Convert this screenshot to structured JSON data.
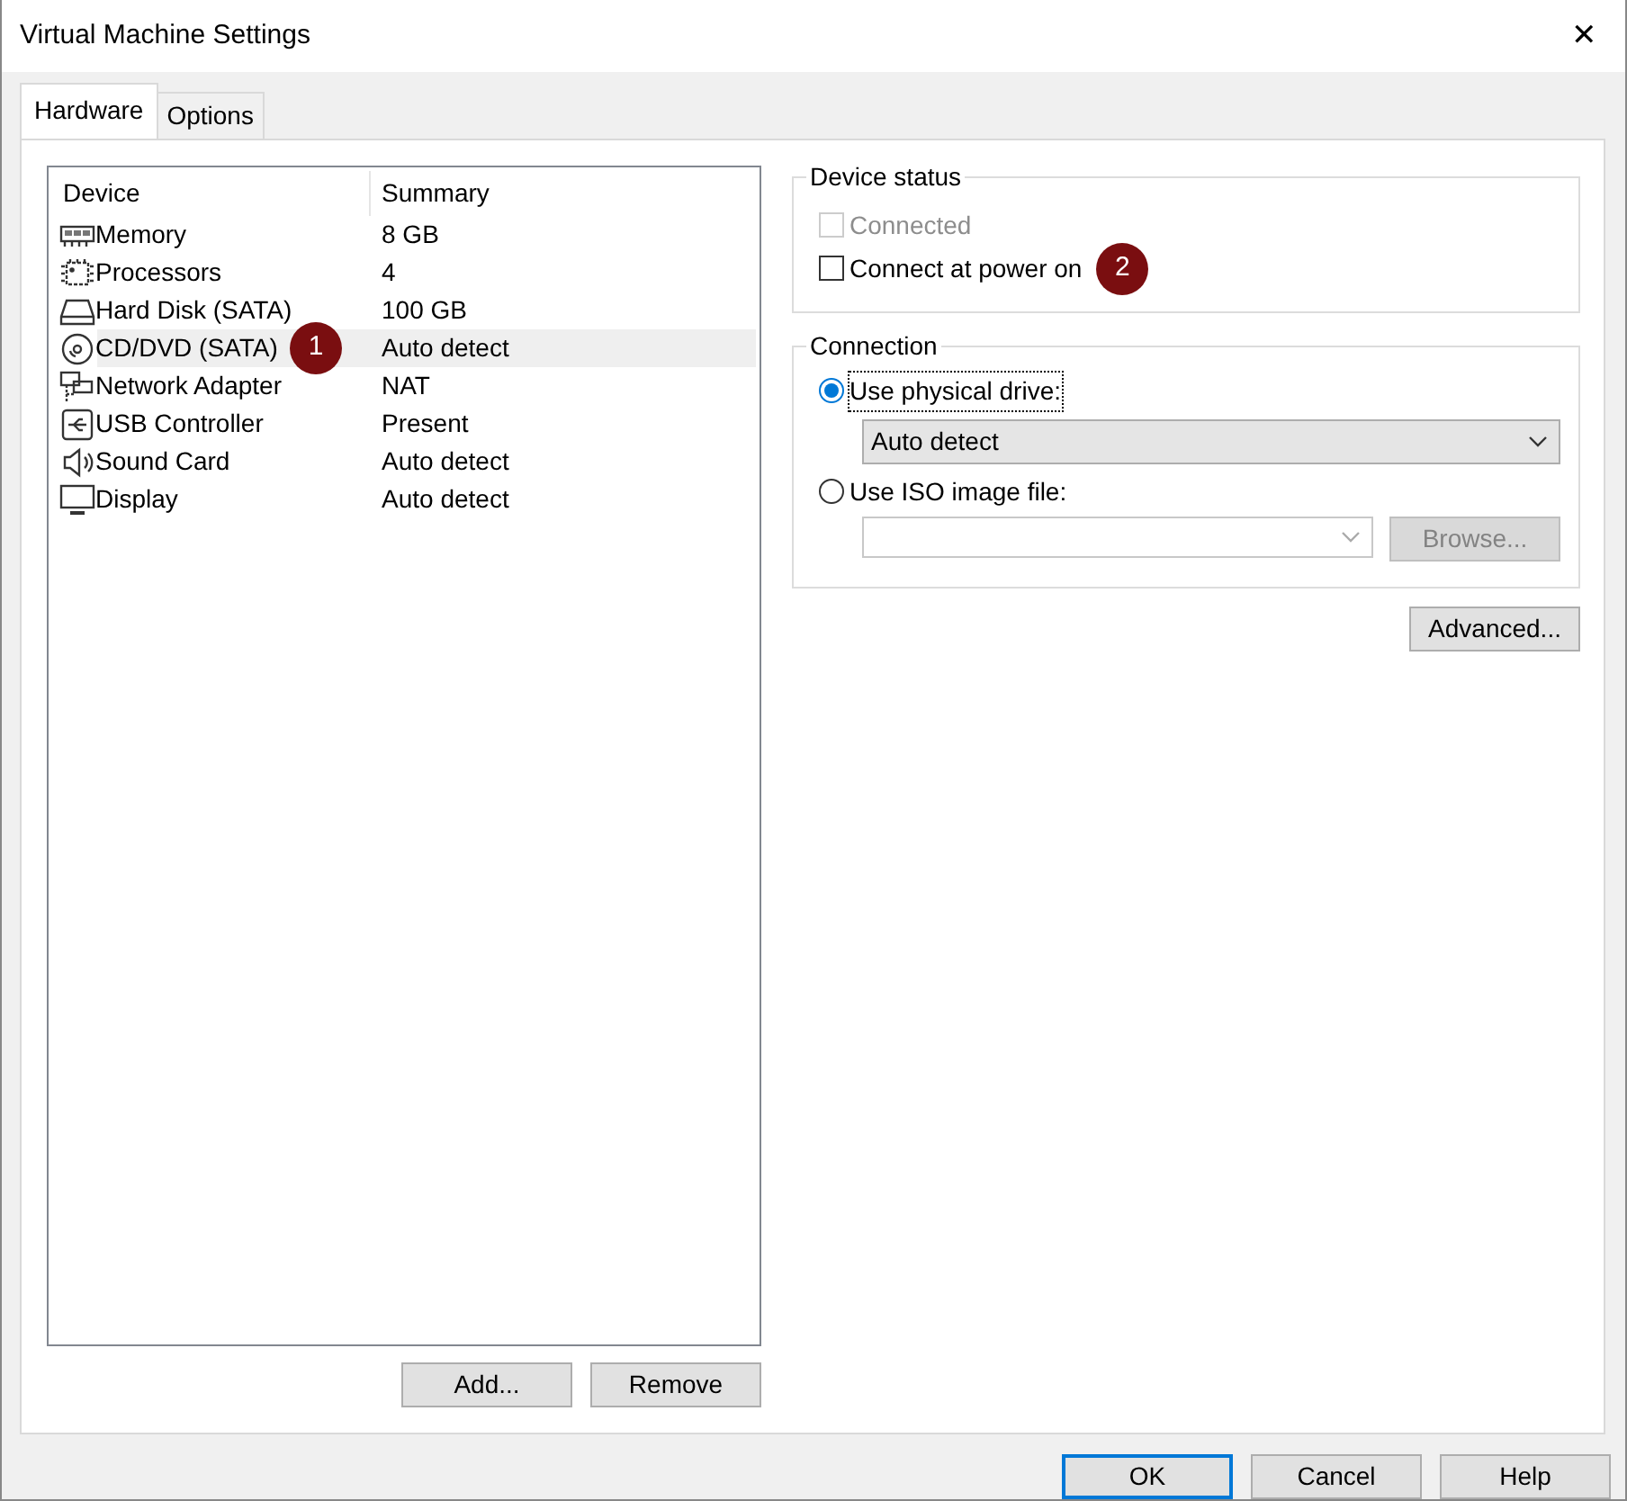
{
  "window": {
    "title": "Virtual Machine Settings",
    "close": "✕"
  },
  "tabs": [
    {
      "label": "Hardware",
      "selected": true
    },
    {
      "label": "Options",
      "selected": false
    }
  ],
  "device_list": {
    "columns": [
      "Device",
      "Summary"
    ],
    "rows": [
      {
        "kind": "memory",
        "device": "Memory",
        "summary": "8 GB",
        "selected": false
      },
      {
        "kind": "processor",
        "device": "Processors",
        "summary": "4",
        "selected": false
      },
      {
        "kind": "disk",
        "device": "Hard Disk (SATA)",
        "summary": "100 GB",
        "selected": false
      },
      {
        "kind": "cd",
        "device": "CD/DVD (SATA)",
        "summary": "Auto detect",
        "selected": true,
        "callout": "1"
      },
      {
        "kind": "network",
        "device": "Network Adapter",
        "summary": "NAT",
        "selected": false
      },
      {
        "kind": "usb",
        "device": "USB Controller",
        "summary": "Present",
        "selected": false
      },
      {
        "kind": "sound",
        "device": "Sound Card",
        "summary": "Auto detect",
        "selected": false
      },
      {
        "kind": "display",
        "device": "Display",
        "summary": "Auto detect",
        "selected": false
      }
    ]
  },
  "list_buttons": [
    "Add...",
    "Remove"
  ],
  "device_status": {
    "title": "Device status",
    "options": [
      {
        "label": "Connected",
        "checked": false,
        "disabled": true
      },
      {
        "label": "Connect at power on",
        "checked": false,
        "disabled": false,
        "callout": "2"
      }
    ]
  },
  "connection": {
    "title": "Connection",
    "options": [
      {
        "kind": "drive",
        "label": "Use physical drive:",
        "selected": true,
        "focused": true,
        "dropdown_value": "Auto detect"
      },
      {
        "kind": "iso",
        "label": "Use ISO image file:",
        "selected": false,
        "focused": false,
        "browse_button": {
          "label": "Browse...",
          "disabled": true
        }
      }
    ]
  },
  "advanced_button": "Advanced...",
  "footer_buttons": [
    {
      "label": "OK",
      "default": true
    },
    {
      "label": "Cancel",
      "default": false
    },
    {
      "label": "Help",
      "default": false
    }
  ]
}
